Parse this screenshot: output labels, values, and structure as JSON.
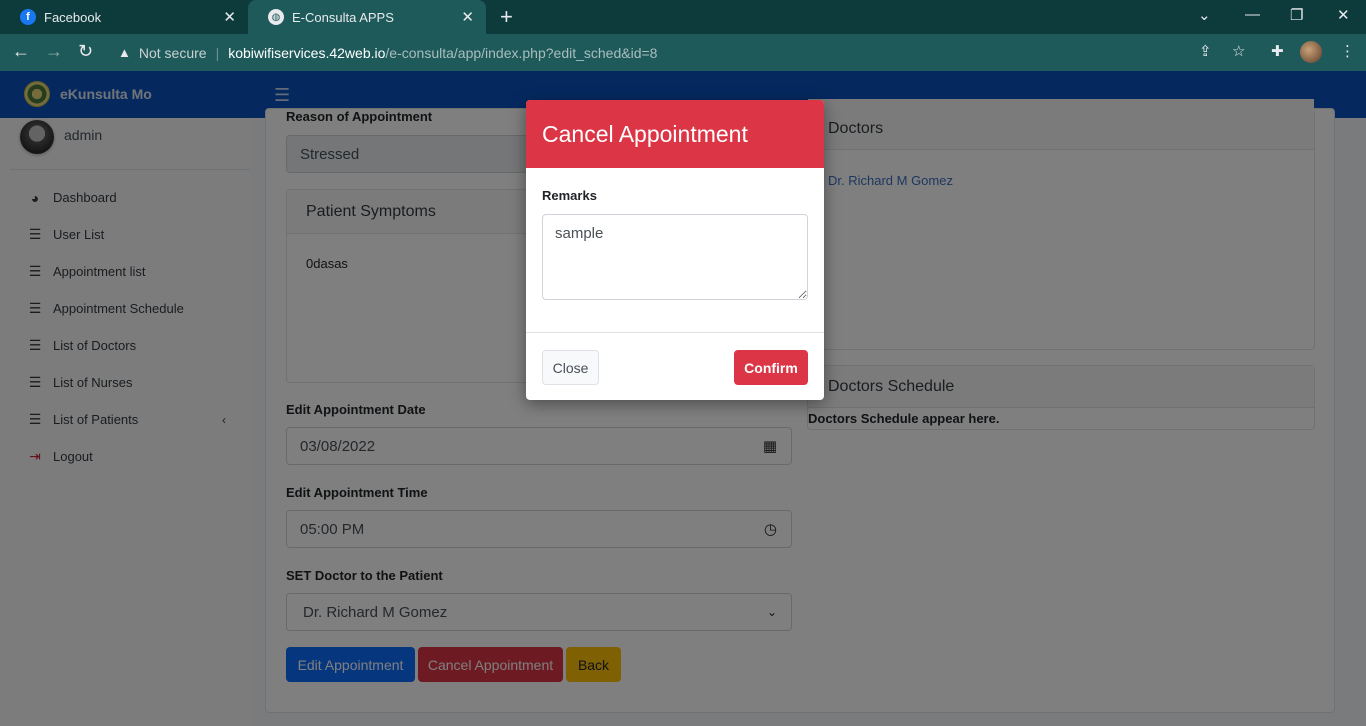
{
  "browser": {
    "tabs": [
      {
        "title": "Facebook",
        "icon": "facebook-icon"
      },
      {
        "title": "E-Consulta APPS",
        "icon": "globe-icon"
      }
    ],
    "security_label": "Not secure",
    "url_host": "kobiwifiservices.42web.io",
    "url_path": "/e-consulta/app/index.php?edit_sched&id=8"
  },
  "app": {
    "brand": "eKunsulta Mo",
    "user": "admin"
  },
  "sidebar": {
    "items": [
      {
        "label": "Dashboard",
        "icon": "tachometer-icon"
      },
      {
        "label": "User List",
        "icon": "list-icon"
      },
      {
        "label": "Appointment list",
        "icon": "list-icon"
      },
      {
        "label": "Appointment Schedule",
        "icon": "list-icon"
      },
      {
        "label": "List of Doctors",
        "icon": "list-icon"
      },
      {
        "label": "List of Nurses",
        "icon": "list-icon"
      },
      {
        "label": "List of Patients",
        "icon": "list-icon"
      },
      {
        "label": "Logout",
        "icon": "sign-out-icon"
      }
    ]
  },
  "form": {
    "reason_label": "Reason of Appointment",
    "reason_value": "Stressed",
    "symptoms_title": "Patient Symptoms",
    "symptoms_value": "0dasas",
    "date_label": "Edit Appointment Date",
    "date_value": "03/08/2022",
    "time_label": "Edit Appointment Time",
    "time_value": "05:00  PM",
    "doctor_label": "SET Doctor to the Patient",
    "doctor_value": "Dr. Richard M Gomez",
    "btn_edit": "Edit Appointment",
    "btn_cancel": "Cancel Appointment",
    "btn_back": "Back"
  },
  "doctors_panel": {
    "title": "Doctors",
    "doctor_link": "Dr. Richard M Gomez"
  },
  "schedule_panel": {
    "title": "Doctors Schedule",
    "text": "Doctors Schedule appear here."
  },
  "modal": {
    "title": "Cancel Appointment",
    "remarks_label": "Remarks",
    "remarks_value": "sample",
    "close_label": "Close",
    "confirm_label": "Confirm"
  },
  "colors": {
    "brand_blue": "#0a53be",
    "danger": "#dc3545",
    "warning": "#d4a017",
    "primary": "#0d6efd"
  }
}
